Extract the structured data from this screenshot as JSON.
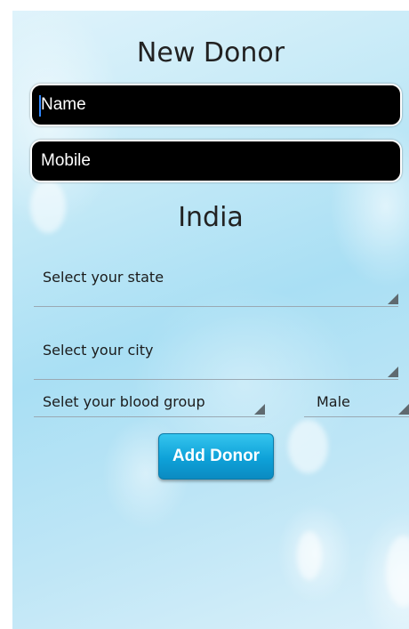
{
  "form": {
    "title": "New Donor",
    "name_placeholder": "Name",
    "mobile_placeholder": "Mobile",
    "country": "India",
    "state_prompt": "Select your state",
    "city_prompt": "Select your city",
    "blood_group_prompt": "Selet your blood group",
    "gender_selected": "Male",
    "submit_label": "Add Donor"
  },
  "colors": {
    "field_background": "#000000",
    "button_accent": "#0ea1d8",
    "cursor": "#2f86ff"
  }
}
